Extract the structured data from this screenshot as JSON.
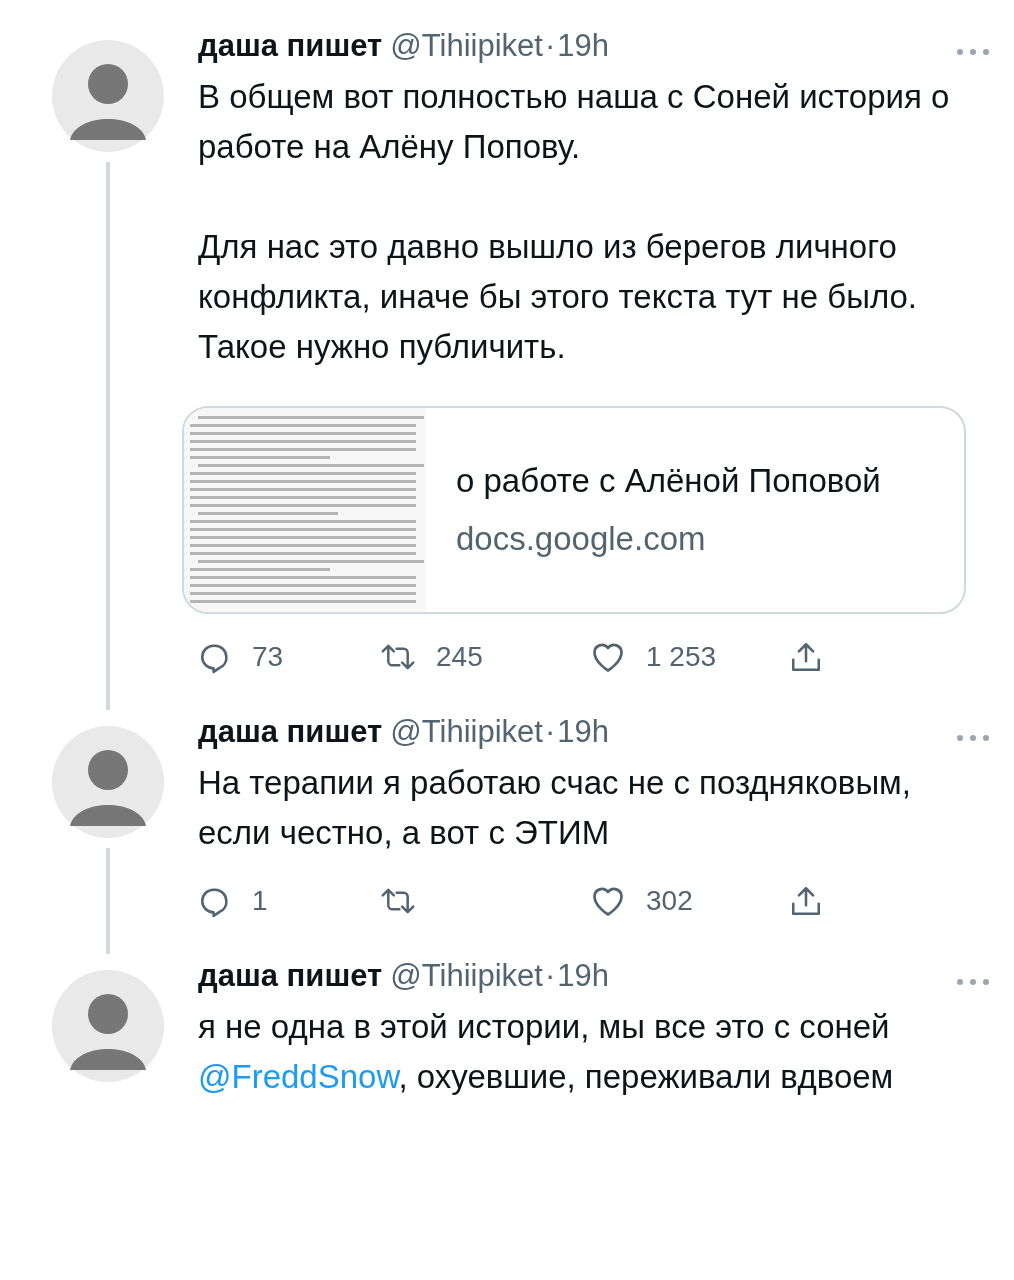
{
  "tweets": [
    {
      "author": "даша пишет",
      "handle": "@Tihiipiket",
      "separator": "·",
      "time": "19h",
      "thread_line": true,
      "paragraphs": [
        [
          {
            "text": "В общем вот полностью наша с Соней история о работе на Алёну Попову."
          }
        ],
        [
          {
            "text": "Для нас это давно вышло из берегов личного конфликта, иначе бы этого текста тут не было. Такое нужно публичить."
          }
        ]
      ],
      "card": {
        "title": "о работе с Алёной Поповой",
        "domain": "docs.google.com"
      },
      "actions": {
        "replies": "73",
        "retweets": "245",
        "likes": "1 253"
      }
    },
    {
      "author": "даша пишет",
      "handle": "@Tihiipiket",
      "separator": "·",
      "time": "19h",
      "thread_line": true,
      "paragraphs": [
        [
          {
            "text": "На терапии я работаю счас не с поздняковым, если честно, а вот с ЭТИМ"
          }
        ]
      ],
      "actions": {
        "replies": "1",
        "likes": "302"
      }
    },
    {
      "author": "даша пишет",
      "handle": "@Tihiipiket",
      "separator": "·",
      "time": "19h",
      "thread_line": false,
      "paragraphs": [
        [
          {
            "text": "я не одна в этой истории, мы все это с соней "
          },
          {
            "text": "@FreddSnow",
            "kind": "mention"
          },
          {
            "text": ", охуевшие, переживали вдвоем"
          }
        ]
      ]
    }
  ]
}
